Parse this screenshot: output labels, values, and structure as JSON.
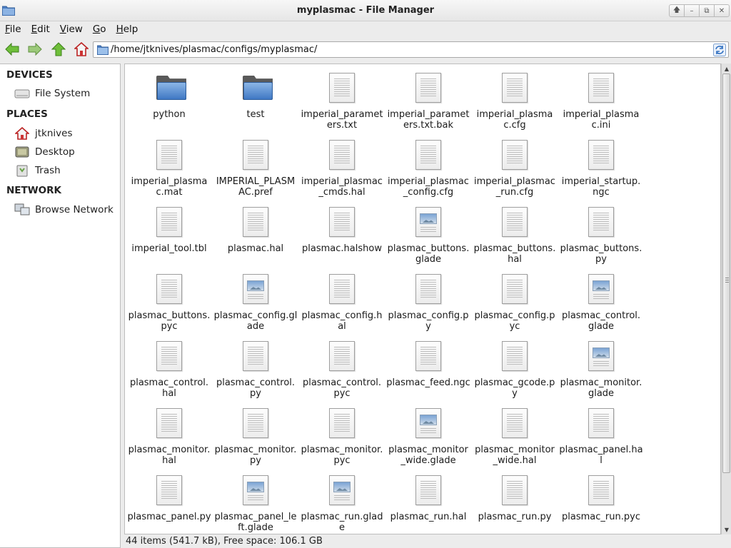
{
  "window": {
    "title": "myplasmac - File Manager",
    "controls": [
      "up",
      "minimize",
      "maximize",
      "close"
    ]
  },
  "menu": [
    {
      "label": "File",
      "mnemonic": "F"
    },
    {
      "label": "Edit",
      "mnemonic": "E"
    },
    {
      "label": "View",
      "mnemonic": "V"
    },
    {
      "label": "Go",
      "mnemonic": "G"
    },
    {
      "label": "Help",
      "mnemonic": "H"
    }
  ],
  "toolbar": {
    "back_icon": "back-arrow-icon",
    "forward_icon": "forward-arrow-icon",
    "up_icon": "up-arrow-icon",
    "home_icon": "home-icon",
    "path": "/home/jtknives/plasmac/configs/myplasmac/",
    "reload_icon": "reload-icon"
  },
  "sidebar": {
    "sections": [
      {
        "title": "DEVICES",
        "items": [
          {
            "label": "File System",
            "icon": "drive-icon"
          }
        ]
      },
      {
        "title": "PLACES",
        "items": [
          {
            "label": "jtknives",
            "icon": "home-icon"
          },
          {
            "label": "Desktop",
            "icon": "desktop-icon"
          },
          {
            "label": "Trash",
            "icon": "trash-icon"
          }
        ]
      },
      {
        "title": "NETWORK",
        "items": [
          {
            "label": "Browse Network",
            "icon": "network-icon"
          }
        ]
      }
    ]
  },
  "files": [
    {
      "name": "python",
      "type": "folder"
    },
    {
      "name": "test",
      "type": "folder"
    },
    {
      "name": "imperial_parameters.txt",
      "type": "doc"
    },
    {
      "name": "imperial_parameters.txt.bak",
      "type": "doc"
    },
    {
      "name": "imperial_plasmac.cfg",
      "type": "doc"
    },
    {
      "name": "imperial_plasmac.ini",
      "type": "doc"
    },
    {
      "name": "imperial_plasmac.mat",
      "type": "doc"
    },
    {
      "name": "IMPERIAL_PLASMAC.pref",
      "type": "doc"
    },
    {
      "name": "imperial_plasmac_cmds.hal",
      "type": "doc"
    },
    {
      "name": "imperial_plasmac_config.cfg",
      "type": "doc"
    },
    {
      "name": "imperial_plasmac_run.cfg",
      "type": "doc"
    },
    {
      "name": "imperial_startup.ngc",
      "type": "doc"
    },
    {
      "name": "imperial_tool.tbl",
      "type": "doc"
    },
    {
      "name": "plasmac.hal",
      "type": "doc"
    },
    {
      "name": "plasmac.halshow",
      "type": "doc"
    },
    {
      "name": "plasmac_buttons.glade",
      "type": "img"
    },
    {
      "name": "plasmac_buttons.hal",
      "type": "doc"
    },
    {
      "name": "plasmac_buttons.py",
      "type": "doc"
    },
    {
      "name": "plasmac_buttons.pyc",
      "type": "doc"
    },
    {
      "name": "plasmac_config.glade",
      "type": "img"
    },
    {
      "name": "plasmac_config.hal",
      "type": "doc"
    },
    {
      "name": "plasmac_config.py",
      "type": "doc"
    },
    {
      "name": "plasmac_config.pyc",
      "type": "doc"
    },
    {
      "name": "plasmac_control.glade",
      "type": "img"
    },
    {
      "name": "plasmac_control.hal",
      "type": "doc"
    },
    {
      "name": "plasmac_control.py",
      "type": "doc"
    },
    {
      "name": "plasmac_control.pyc",
      "type": "doc"
    },
    {
      "name": "plasmac_feed.ngc",
      "type": "doc"
    },
    {
      "name": "plasmac_gcode.py",
      "type": "doc"
    },
    {
      "name": "plasmac_monitor.glade",
      "type": "img"
    },
    {
      "name": "plasmac_monitor.hal",
      "type": "doc"
    },
    {
      "name": "plasmac_monitor.py",
      "type": "doc"
    },
    {
      "name": "plasmac_monitor.pyc",
      "type": "doc"
    },
    {
      "name": "plasmac_monitor_wide.glade",
      "type": "img"
    },
    {
      "name": "plasmac_monitor_wide.hal",
      "type": "doc"
    },
    {
      "name": "plasmac_panel.hal",
      "type": "doc"
    },
    {
      "name": "plasmac_panel.py",
      "type": "doc"
    },
    {
      "name": "plasmac_panel_left.glade",
      "type": "img"
    },
    {
      "name": "plasmac_run.glade",
      "type": "img"
    },
    {
      "name": "plasmac_run.hal",
      "type": "doc"
    },
    {
      "name": "plasmac_run.py",
      "type": "doc"
    },
    {
      "name": "plasmac_run.pyc",
      "type": "doc"
    }
  ],
  "status": "44 items (541.7 kB), Free space: 106.1 GB"
}
